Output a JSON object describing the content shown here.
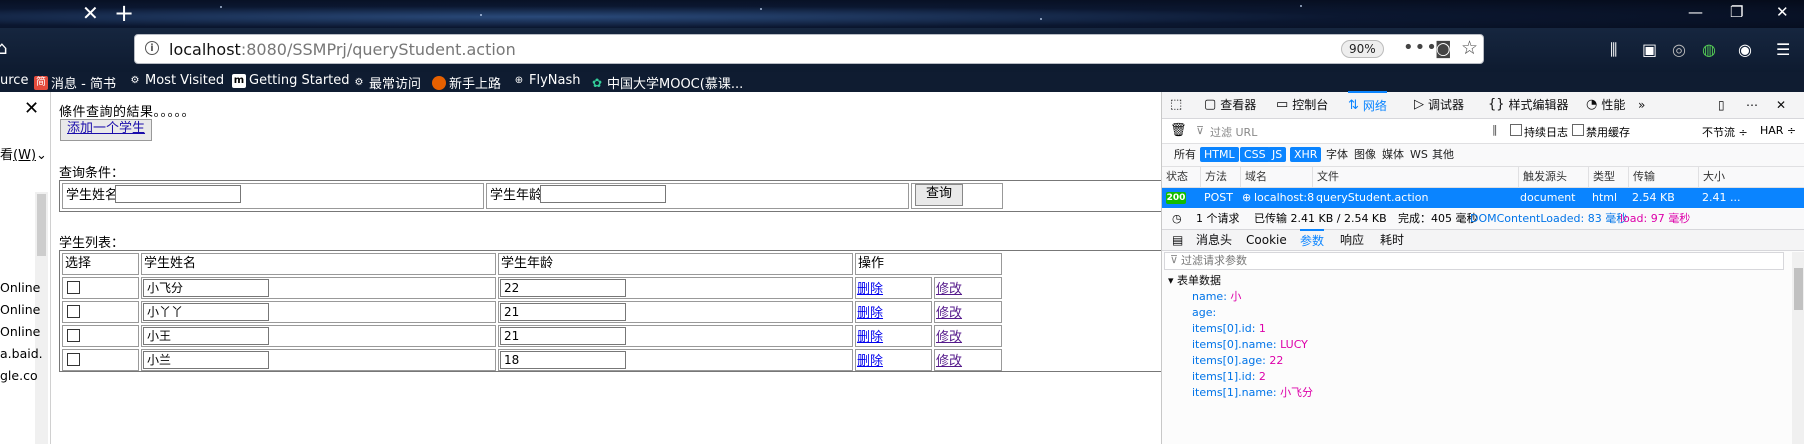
{
  "browser": {
    "url_host": "localhost",
    "url_rest": ":8080/SSMPrj/queryStudent.action",
    "zoom": "90%",
    "bookmarks": [
      {
        "icon": "jianshu-icon",
        "label": "消息 - 简书"
      },
      {
        "icon": "gear-icon",
        "label": "Most Visited"
      },
      {
        "icon": "mdn-icon",
        "label": "Getting Started"
      },
      {
        "icon": "gear-icon",
        "label": "最常访问"
      },
      {
        "icon": "firefox-icon",
        "label": "新手上路"
      },
      {
        "icon": "globe-icon",
        "label": "FlyNash"
      },
      {
        "icon": "mooc-icon",
        "label": "中国大学MOOC(慕课..."
      }
    ],
    "bookmark_left_fragment": "urce"
  },
  "sidebar": {
    "menu_label": "(W)",
    "menu_prefix": "看",
    "items": [
      "Online",
      "Online",
      "Online",
      "a.baid.",
      "gle.co"
    ]
  },
  "page": {
    "result_title": "條件查詢的結果。。。。。",
    "add_button": "添加一个学生",
    "query_label": "查询条件：",
    "query_name_label": "学生姓名:",
    "query_age_label": "学生年龄:",
    "query_button": "查询",
    "list_label": "学生列表：",
    "columns": [
      "选择",
      "学生姓名",
      "学生年龄",
      "操作"
    ],
    "rows": [
      {
        "name": "小飞分",
        "age": "22",
        "delete": "删除",
        "edit": "修改"
      },
      {
        "name": "小丫丫",
        "age": "21",
        "delete": "删除",
        "edit": "修改"
      },
      {
        "name": "小王",
        "age": "21",
        "delete": "删除",
        "edit": "修改"
      },
      {
        "name": "小兰",
        "age": "18",
        "delete": "删除",
        "edit": "修改"
      }
    ]
  },
  "devtools": {
    "tabs": [
      "查看器",
      "控制台",
      "网络",
      "调试器",
      "样式编辑器",
      "性能"
    ],
    "active_tab": "网络",
    "filter_placeholder": "过滤 URL",
    "persist_log": "持续日志",
    "disable_cache": "禁用缓存",
    "throttle": "不节流 ÷",
    "har": "HAR ÷",
    "types": [
      "所有",
      "HTML",
      "CSS",
      "JS",
      "XHR",
      "字体",
      "图像",
      "媒体",
      "WS",
      "其他"
    ],
    "selected_types": [
      "HTML",
      "CSS",
      "JS",
      "XHR"
    ],
    "headers": [
      "状态",
      "方法",
      "域名",
      "文件",
      "触发源头",
      "类型",
      "传输",
      "大小"
    ],
    "request": {
      "status": "200",
      "method": "POST",
      "domain": "localhost:8...",
      "file": "queryStudent.action",
      "cause": "document",
      "type": "html",
      "transferred": "2.54 KB",
      "size": "2.41 ..."
    },
    "summary": {
      "requests": "1 个请求",
      "transferred": "已传输 2.41 KB / 2.54 KB",
      "finish": "完成：405 毫秒",
      "dcl": "DOMContentLoaded: 83 毫秒",
      "load": "load: 97 毫秒"
    },
    "detail_tabs": [
      "消息头",
      "Cookie",
      "参数",
      "响应",
      "耗时"
    ],
    "active_detail_tab": "参数",
    "param_filter_placeholder": "过滤请求参数",
    "params_header": "表单数据",
    "params": [
      {
        "key": "name:",
        "value": "小"
      },
      {
        "key": "age:",
        "value": ""
      },
      {
        "key": "items[0].id:",
        "value": "1"
      },
      {
        "key": "items[0].name:",
        "value": "LUCY"
      },
      {
        "key": "items[0].age:",
        "value": "22"
      },
      {
        "key": "items[1].id:",
        "value": "2"
      },
      {
        "key": "items[1].name:",
        "value": "小飞分"
      }
    ]
  }
}
